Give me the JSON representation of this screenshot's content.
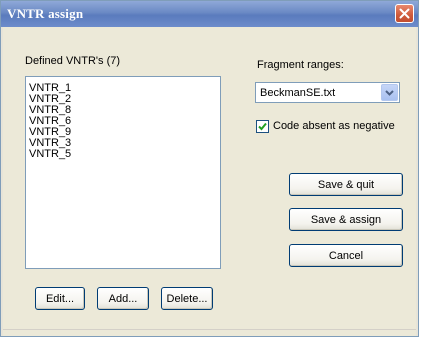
{
  "window": {
    "title": "VNTR assign"
  },
  "vntr_list": {
    "label": "Defined VNTR's (7)",
    "items": [
      "VNTR_1",
      "VNTR_2",
      "VNTR_8",
      "VNTR_6",
      "VNTR_9",
      "VNTR_3",
      "VNTR_5"
    ]
  },
  "list_buttons": {
    "edit_label": "Edit...",
    "add_label": "Add...",
    "delete_label": "Delete..."
  },
  "fragment_ranges": {
    "label": "Fragment ranges:",
    "selected": "BeckmanSE.txt"
  },
  "code_absent": {
    "label": "Code absent as negative",
    "checked": true
  },
  "actions": {
    "save_quit_label": "Save & quit",
    "save_assign_label": "Save & assign",
    "cancel_label": "Cancel"
  },
  "icons": {
    "close": "close-icon",
    "dropdown": "chevron-down-icon",
    "check": "checkmark-icon"
  },
  "colors": {
    "titlebar": "#6a89c4",
    "close_button": "#cf5a3a",
    "dialog_background": "#ece9d8",
    "list_border": "#7f9db9",
    "check_mark": "#21a121"
  }
}
